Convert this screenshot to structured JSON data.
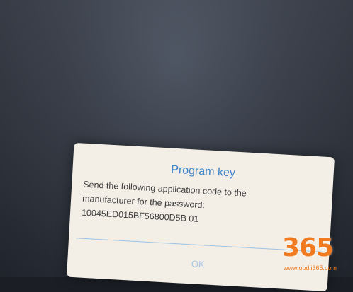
{
  "dialog": {
    "title": "Program key",
    "message_lines": [
      "Send the following application code to the",
      "manufacturer for the password:",
      "10045ED015BF56800D5B 01"
    ],
    "ok_label": "OK"
  },
  "watermark": {
    "logo_text": "365",
    "url": "www.obdii365.com",
    "color": "#f07a1d"
  },
  "colors": {
    "title": "#3e86c9",
    "dialog_background": "#f3efe7",
    "screen_background": "#2c3139"
  }
}
